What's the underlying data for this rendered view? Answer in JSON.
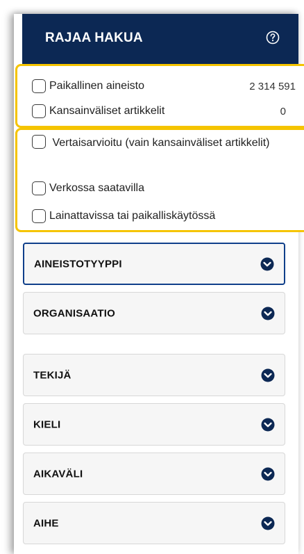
{
  "header": {
    "title": "RAJAA HAKUA",
    "help_icon": "question-circle-icon",
    "background": "#0c2854"
  },
  "group1": {
    "items": [
      {
        "label": "Paikallinen aineisto",
        "count": "2 314 591"
      },
      {
        "label": "Kansainväliset artikkelit",
        "count": "0"
      }
    ]
  },
  "group2": {
    "items": [
      {
        "label": "Vertaisarvioitu (vain kansainväliset artikkelit)"
      },
      {
        "label": "Verkossa saatavilla"
      },
      {
        "label": "Lainattavissa tai paikalliskäytössä"
      }
    ]
  },
  "facets": [
    {
      "label": "AINEISTOTYYPPI",
      "icon": "chevron-down-circle-icon"
    },
    {
      "label": "ORGANISAATIO",
      "icon": "chevron-down-circle-icon"
    },
    {
      "label": "TEKIJÄ",
      "icon": "chevron-down-circle-icon"
    },
    {
      "label": "KIELI",
      "icon": "chevron-down-circle-icon"
    },
    {
      "label": "AIKAVÄLI",
      "icon": "chevron-down-circle-icon"
    },
    {
      "label": "AIHE",
      "icon": "chevron-down-circle-icon"
    }
  ],
  "colors": {
    "highlight": "#f5c400",
    "accent_border": "#0f3f8a"
  }
}
